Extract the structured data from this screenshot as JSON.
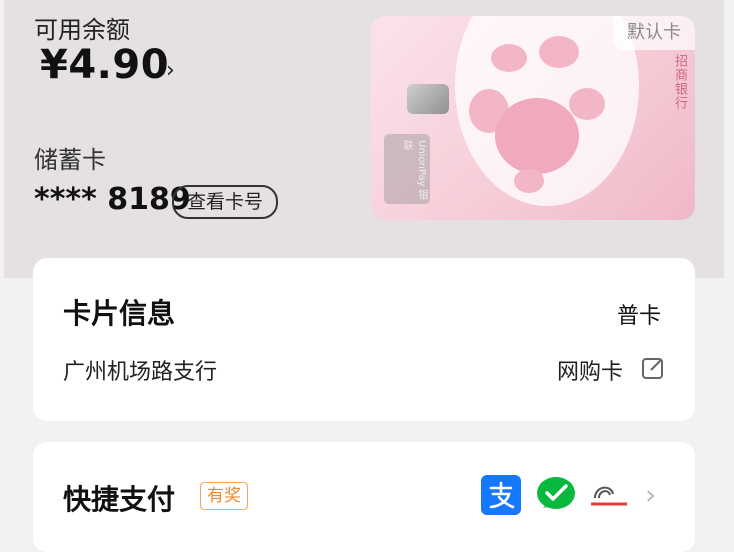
{
  "account": {
    "balance_label": "可用余额",
    "balance_amount": "¥4.90",
    "chevron": "›",
    "card_type": "储蓄卡",
    "card_number": "**** 8189",
    "view_number_label": "查看卡号"
  },
  "card_image": {
    "default_badge": "默认卡",
    "bank_name": "招商银行",
    "network_label": "UnionPay 银联"
  },
  "card_info": {
    "title": "卡片信息",
    "level": "普卡",
    "branch": "广州机场路支行",
    "alias": "网购卡",
    "edit_icon": "edit-icon"
  },
  "quick_pay": {
    "title": "快捷支付",
    "badge": "有奖",
    "chevron": "›",
    "icons": [
      "alipay-icon",
      "wechat-pay-icon",
      "shanpay-icon"
    ]
  },
  "colors": {
    "top_bg": "#e5e1e2",
    "card_pink": "#f6cdd8",
    "reward_orange": "#ef8a33",
    "alipay_blue": "#1677ff",
    "wechat_green": "#09b83e"
  }
}
